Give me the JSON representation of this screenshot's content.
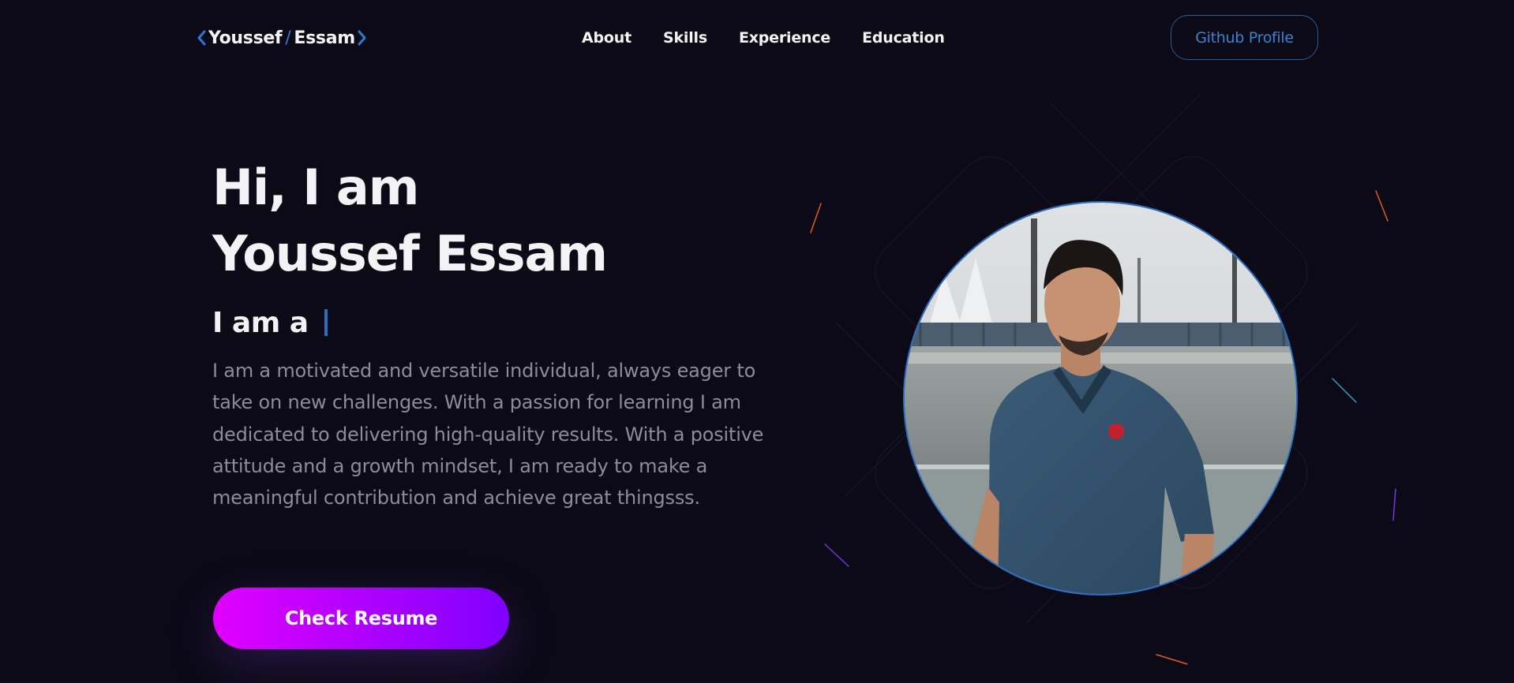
{
  "logo": {
    "first": "Youssef",
    "separator": "/",
    "last": "Essam"
  },
  "nav": {
    "items": [
      "About",
      "Skills",
      "Experience",
      "Education"
    ]
  },
  "github_button": "Github Profile",
  "hero": {
    "greeting": "Hi, I am",
    "name": "Youssef Essam",
    "role_prefix": "I am a",
    "description": "I am a motivated and versatile individual, always eager to take on new challenges. With a passion for learning I am dedicated to delivering high-quality results. With a positive attitude and a growth mindset, I am ready to make a meaningful contribution and achieve great thingsss.",
    "resume_button": "Check Resume"
  },
  "colors": {
    "background": "#0b0a16",
    "accent_blue": "#2d7ad6",
    "button_gradient_start": "#e100ff",
    "button_gradient_end": "#7f00ff"
  },
  "icons": {
    "logo_left": "chevron-left-icon",
    "logo_right": "chevron-right-icon"
  }
}
